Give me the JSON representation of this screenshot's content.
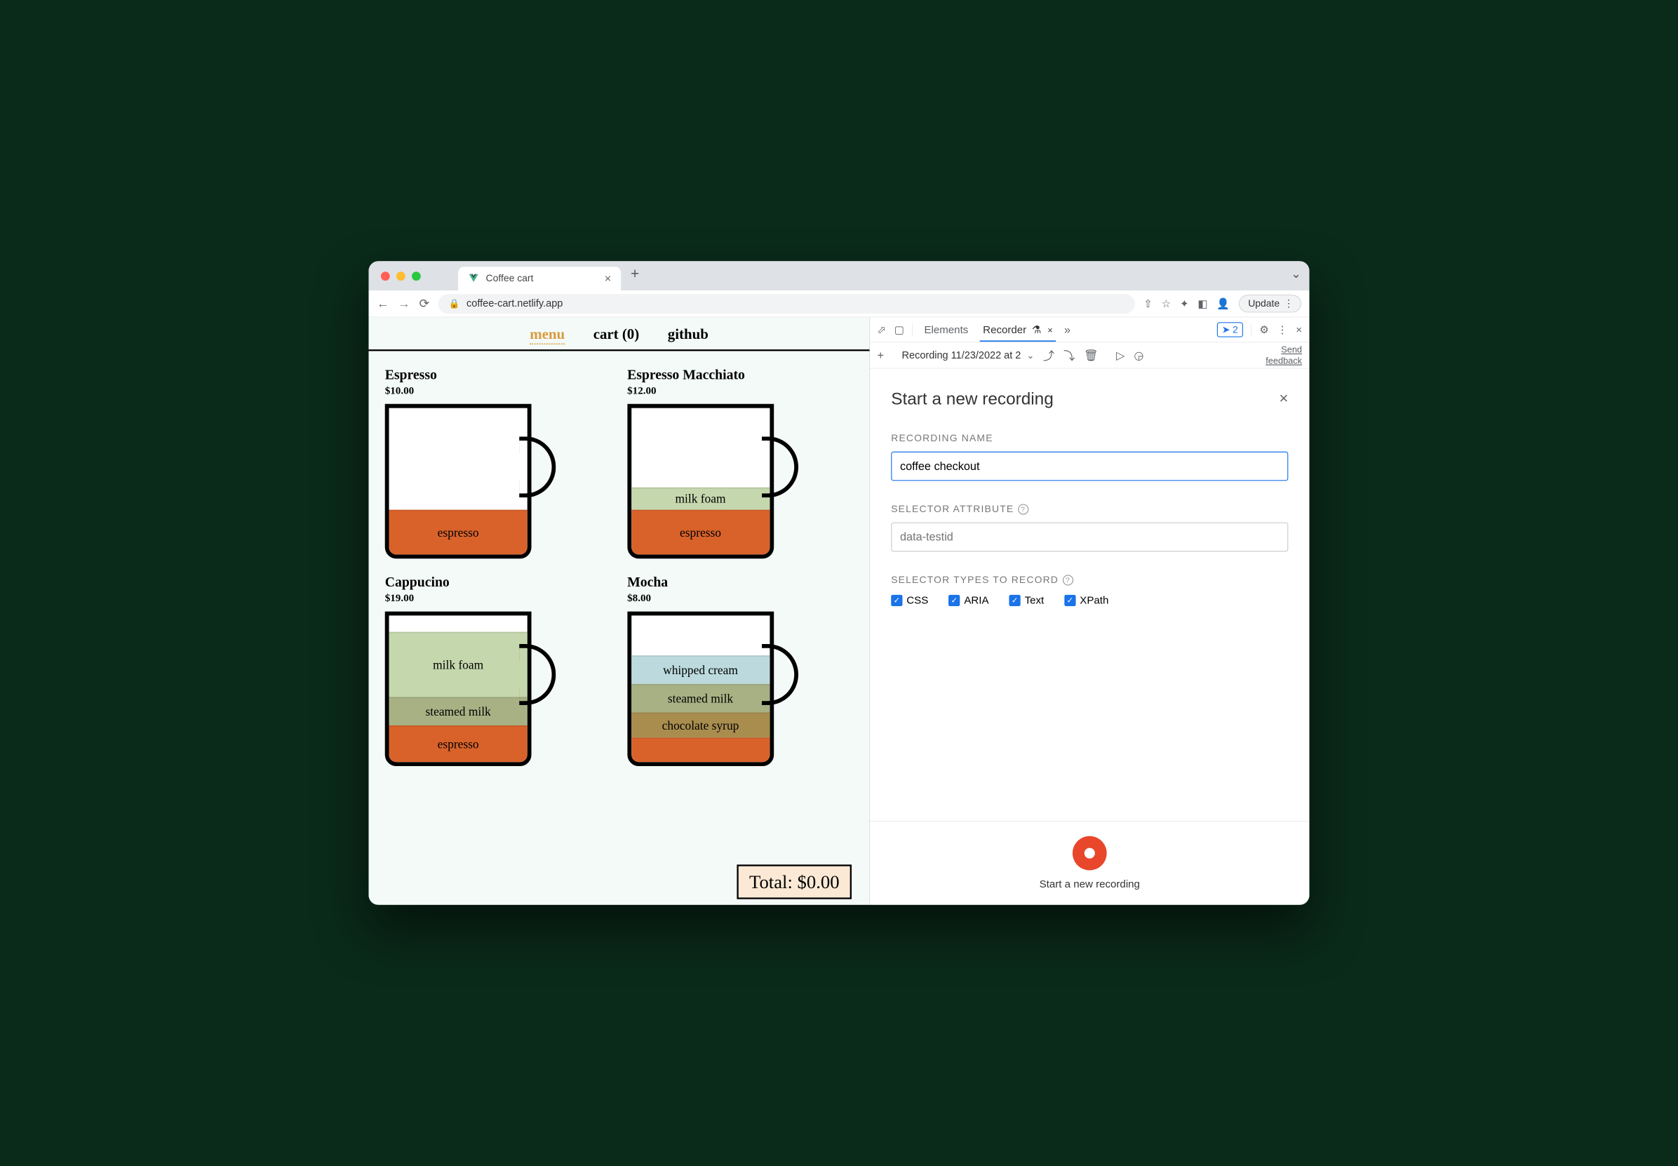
{
  "browser": {
    "tab_title": "Coffee cart",
    "url": "coffee-cart.netlify.app",
    "update_label": "Update"
  },
  "page": {
    "nav": {
      "menu": "menu",
      "cart": "cart (0)",
      "github": "github"
    },
    "items": [
      {
        "name": "Espresso",
        "price": "$10.00"
      },
      {
        "name": "Espresso Macchiato",
        "price": "$12.00"
      },
      {
        "name": "Cappucino",
        "price": "$19.00"
      },
      {
        "name": "Mocha",
        "price": "$8.00"
      }
    ],
    "layers": {
      "espresso": "espresso",
      "milk_foam": "milk foam",
      "steamed_milk": "steamed milk",
      "whipped_cream": "whipped cream",
      "chocolate_syrup": "chocolate syrup"
    },
    "total": "Total: $0.00"
  },
  "devtools": {
    "tabs": {
      "elements": "Elements",
      "recorder": "Recorder"
    },
    "issue_count": "2",
    "recording_select": "Recording 11/23/2022 at 2",
    "feedback": {
      "l1": "Send",
      "l2": "feedback"
    },
    "form": {
      "title": "Start a new recording",
      "name_label": "RECORDING NAME",
      "name_value": "coffee checkout",
      "attr_label": "SELECTOR ATTRIBUTE",
      "attr_placeholder": "data-testid",
      "types_label": "SELECTOR TYPES TO RECORD",
      "checks": {
        "css": "CSS",
        "aria": "ARIA",
        "text": "Text",
        "xpath": "XPath"
      },
      "footer": "Start a new recording"
    }
  }
}
